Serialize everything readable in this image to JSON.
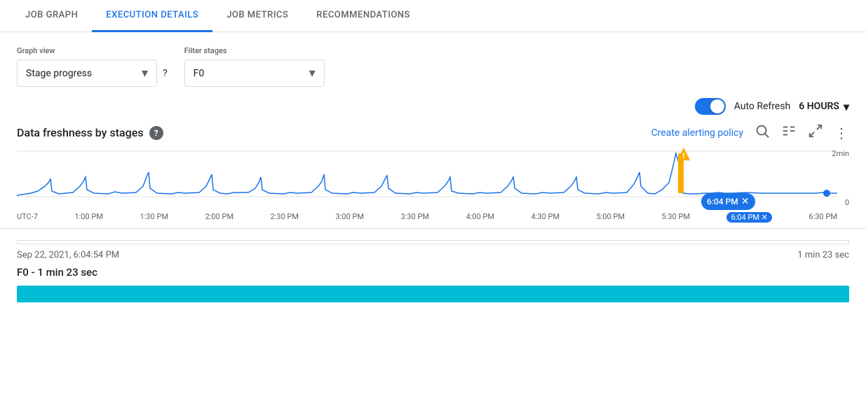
{
  "tabs": [
    {
      "id": "job-graph",
      "label": "JOB GRAPH",
      "active": false
    },
    {
      "id": "execution-details",
      "label": "EXECUTION DETAILS",
      "active": true
    },
    {
      "id": "job-metrics",
      "label": "JOB METRICS",
      "active": false
    },
    {
      "id": "recommendations",
      "label": "RECOMMENDATIONS",
      "active": false
    }
  ],
  "controls": {
    "graph_view": {
      "label": "Graph view",
      "value": "Stage progress",
      "help_label": "?"
    },
    "filter_stages": {
      "label": "Filter stages",
      "value": "F0"
    }
  },
  "auto_refresh": {
    "label": "Auto Refresh",
    "hours_label": "6 HOURS",
    "enabled": true
  },
  "chart": {
    "title": "Data freshness by stages",
    "help_label": "?",
    "create_alert_label": "Create alerting policy",
    "y_max_label": "2min",
    "y_min_label": "0",
    "selected_time": "6:04 PM",
    "time_labels": [
      "UTC-7",
      "1:00 PM",
      "1:30 PM",
      "2:00 PM",
      "2:30 PM",
      "3:00 PM",
      "3:30 PM",
      "4:00 PM",
      "4:30 PM",
      "5:00 PM",
      "5:30 PM",
      "6:30 PM"
    ]
  },
  "bottom_panel": {
    "timestamp": "Sep 22, 2021, 6:04:54 PM",
    "duration": "1 min 23 sec",
    "stage_label": "F0 - 1 min 23 sec",
    "progress_percent": 100
  }
}
